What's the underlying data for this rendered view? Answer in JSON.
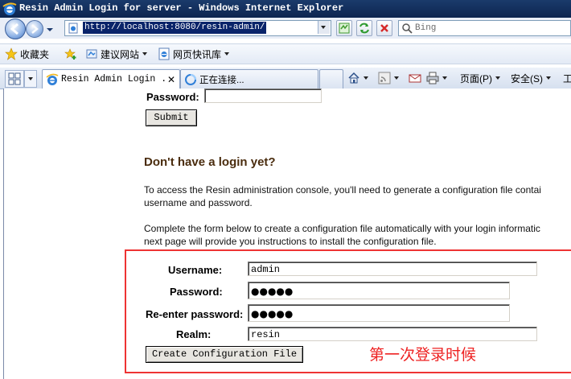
{
  "window": {
    "title": "Resin Admin Login for server - Windows Internet Explorer"
  },
  "address_bar": {
    "url": "http://localhost:8080/resin-admin/"
  },
  "search": {
    "placeholder": "Bing"
  },
  "favorites_bar": {
    "favorites_label": "收藏夹",
    "items": [
      {
        "label": "建议网站"
      },
      {
        "label": "网页快讯库"
      }
    ]
  },
  "tabs": [
    {
      "label": "Resin Admin Login ...",
      "close": "✕"
    },
    {
      "label": "正在连接..."
    }
  ],
  "command_bar": {
    "page_label": "页面(P)",
    "safety_label": "安全(S)",
    "tools_label": "工"
  },
  "login": {
    "password_label": "Password:",
    "password_value": "",
    "submit_label": "Submit"
  },
  "signup": {
    "heading": "Don't have a login yet?",
    "para1_line1": "To access the Resin administration console, you'll need to generate a configuration file contai",
    "para1_line2": "username and password.",
    "para2_line1": "Complete the form below to create a configuration file automatically with your login informatic",
    "para2_line2": "next page will provide you instructions to install the configuration file."
  },
  "config_form": {
    "username_label": "Username:",
    "username_value": "admin",
    "password_label": "Password:",
    "password_value": "●●●●●",
    "reenter_label": "Re-enter password:",
    "reenter_value": "●●●●●",
    "realm_label": "Realm:",
    "realm_value": "resin",
    "create_button_label": "Create Configuration File"
  },
  "annotation": {
    "text": "第一次登录时候",
    "color": "#e22222"
  },
  "colors": {
    "titlebar": "#0d2550",
    "heading": "#4a2c0e",
    "url_highlight": "#0a246a",
    "annotation_frame": "#e33333"
  }
}
